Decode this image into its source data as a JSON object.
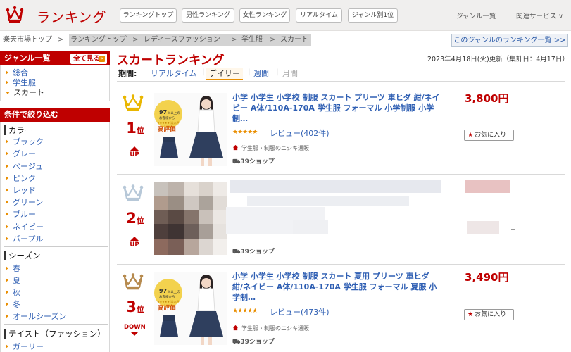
{
  "header": {
    "logo_text": "ランキング",
    "nav": [
      "ランキングトップ",
      "男性ランキング",
      "女性ランキング",
      "リアルタイム",
      "ジャンル別1位"
    ],
    "genre_list": "ジャンル一覧",
    "related_services": "関連サービス ∨"
  },
  "breadcrumb": {
    "items": [
      "楽天市場トップ",
      "ランキングトップ",
      "レディースファッション",
      "学生服",
      "スカート"
    ],
    "separator": ">",
    "genre_ranking_link": "このジャンルのランキング一覧 >>"
  },
  "sidebar": {
    "genre_header": "ジャンル一覧",
    "see_all": "全て見る",
    "see_all_mark": "»",
    "genres": [
      "総合",
      "学生服",
      "スカート"
    ],
    "filter_header": "条件で絞り込む",
    "sections": [
      {
        "title": "カラー",
        "items": [
          "ブラック",
          "グレー",
          "ベージュ",
          "ピンク",
          "レッド",
          "グリーン",
          "ブルー",
          "ネイビー",
          "パープル"
        ]
      },
      {
        "title": "シーズン",
        "items": [
          "春",
          "夏",
          "秋",
          "冬",
          "オールシーズン"
        ]
      },
      {
        "title": "テイスト（ファッション）",
        "items": [
          "ガーリー"
        ]
      }
    ]
  },
  "main": {
    "title": "スカートランキング",
    "update": "2023年4月18日(火)更新（集計日：4月17日）",
    "period_label": "期間:",
    "periods": [
      "リアルタイム",
      "デイリー",
      "週間",
      "月間"
    ],
    "separator": "|",
    "items": [
      {
        "rank": "1",
        "rank_suffix": "位",
        "trend": "UP",
        "title": "小学 小学生 小学校 制服 スカート プリーツ 車ヒダ 紺/ネイビー A体/110A-170A 学生服 フォーマル 小学制服 小学制…",
        "rating_stars": "★★★★★",
        "review": "レビュー(402件)",
        "category": "学生服・制服のニシキ通販",
        "shop": "39ショップ",
        "shop_icon": "truck-icon",
        "price": "3,800円",
        "favorite": "お気に入り",
        "thumb_badge_top": "97",
        "thumb_badge_text": "%以上の\nお客様から",
        "thumb_badge_stars": "★★★★★ 満点評",
        "thumb_label": "高評価",
        "crown_color": "#e9b600"
      },
      {
        "rank": "2",
        "rank_suffix": "位",
        "trend": "UP",
        "title": "",
        "rating_stars": "",
        "review": "",
        "category": "",
        "shop": "39ショップ",
        "shop_icon": "truck-icon",
        "price": "",
        "favorite": "",
        "crown_color": "#b7c8d8"
      },
      {
        "rank": "3",
        "rank_suffix": "位",
        "trend": "DOWN",
        "title": "小学 小学生 小学校 制服 スカート 夏用 プリーツ 車ヒダ 紺/ネイビー A体/110A-170A 学生服 フォーマル 夏服 小学制…",
        "rating_stars": "★★★★★",
        "review": "レビュー(473件)",
        "category": "学生服・制服のニシキ通販",
        "shop": "39ショップ",
        "shop_icon": "truck-icon",
        "price": "3,490円",
        "favorite": "お気に入り",
        "thumb_badge_top": "97",
        "thumb_badge_text": "%以上の\nお客様から",
        "thumb_badge_stars": "★★★★★ 満点評",
        "thumb_label": "高評価",
        "crown_color": "#b68a4e"
      }
    ]
  },
  "colors": {
    "brand_red": "#bf0000",
    "accent_orange": "#e98e00",
    "link_blue": "#2f5fb3"
  }
}
